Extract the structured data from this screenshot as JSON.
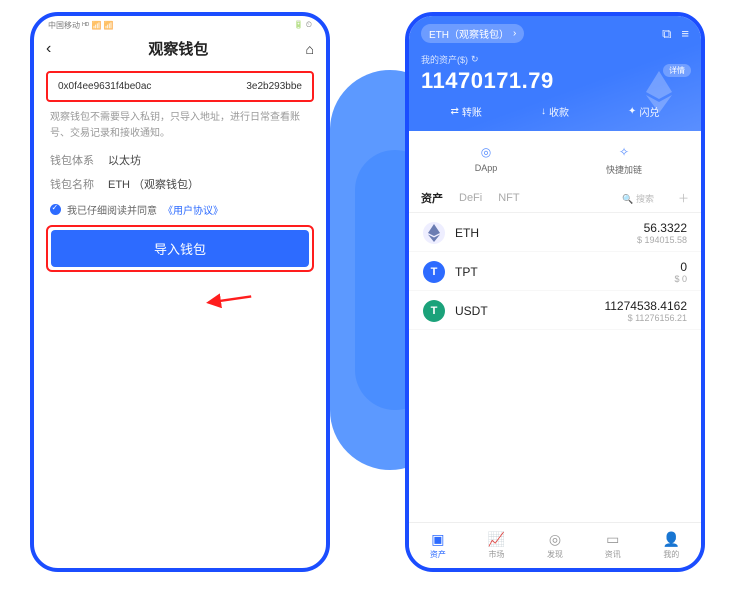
{
  "left": {
    "status_left": "中国移动 ᴴᴰ 📶 📶",
    "status_right": "🔋 ⏲",
    "title": "观察钱包",
    "addr_left": "0x0f4ee9631f4be0ac",
    "addr_right": "3e2b293bbe",
    "note": "观察钱包不需要导入私钥，只导入地址，进行日常查看账号、交易记录和接收通知。",
    "system_lbl": "钱包体系",
    "system_val": "以太坊",
    "name_lbl": "钱包名称",
    "name_val": "ETH （观察钱包）",
    "agree_txt": "我已仔细阅读并同意",
    "agree_link": "《用户协议》",
    "import_btn": "导入钱包"
  },
  "right": {
    "pill_net": "ETH（观察钱包）",
    "assets_lbl": "我的资产($)",
    "assets_amt": "11470171.79",
    "detail": "详情",
    "actions": {
      "transfer": "转账",
      "receive": "收款",
      "swap": "闪兑"
    },
    "quick": {
      "dapp": "DApp",
      "link": "快捷加链"
    },
    "tabs": {
      "assets": "资产",
      "defi": "DeFi",
      "nft": "NFT",
      "search": "搜索"
    },
    "tokens": [
      {
        "sym": "ETH",
        "amt": "56.3322",
        "usd": "$ 194015.58"
      },
      {
        "sym": "TPT",
        "amt": "0",
        "usd": "$ 0"
      },
      {
        "sym": "USDT",
        "amt": "11274538.4162",
        "usd": "$ 11276156.21"
      }
    ],
    "tabbar": {
      "assets": "资产",
      "market": "市场",
      "discover": "发现",
      "news": "资讯",
      "me": "我的"
    }
  }
}
